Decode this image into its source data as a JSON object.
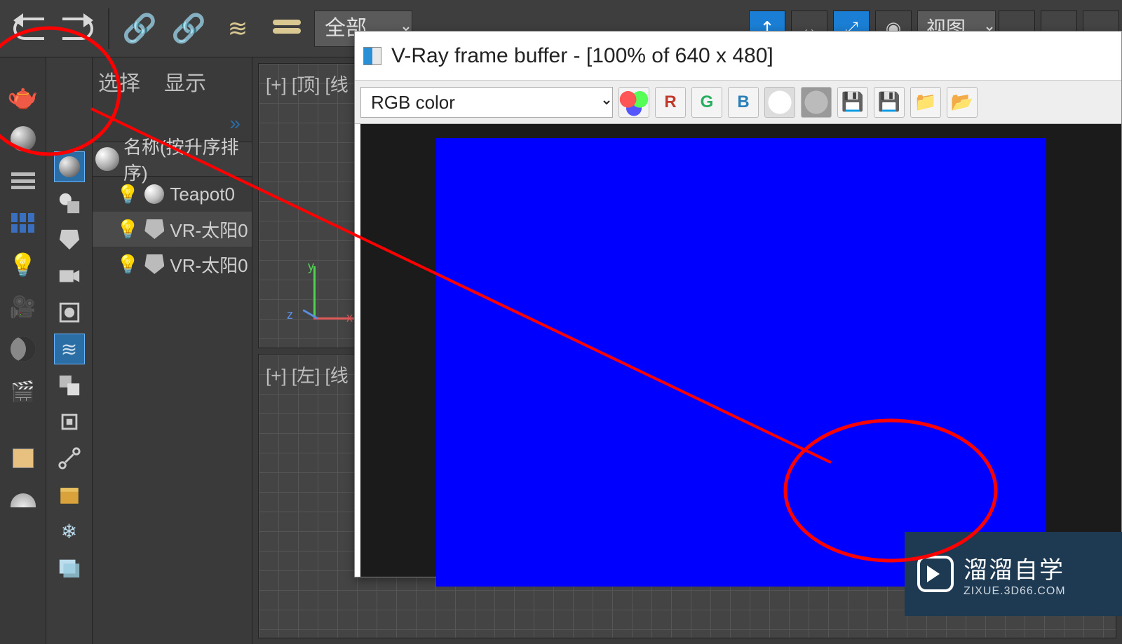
{
  "topbar": {
    "filter_label": "全部",
    "view_label": "视图"
  },
  "scene_explorer": {
    "tabs": {
      "select": "选择",
      "display": "显示"
    },
    "expand_glyph": "»",
    "column_header": "名称(按升序排序)",
    "items": [
      {
        "name": "Teapot0",
        "type": "geometry"
      },
      {
        "name": "VR-太阳0",
        "type": "light"
      },
      {
        "name": "VR-太阳0",
        "type": "light"
      }
    ]
  },
  "viewports": {
    "top_label": "[+] [顶] [线",
    "left_label": "[+] [左] [线",
    "axis": {
      "x": "x",
      "y": "y",
      "z": "z"
    }
  },
  "vfb": {
    "title": "V-Ray frame buffer - [100% of 640 x 480]",
    "channel_select": "RGB color",
    "buttons": {
      "r": "R",
      "g": "G",
      "b": "B"
    }
  },
  "watermark": {
    "title": "溜溜自学",
    "url": "ZIXUE.3D66.COM"
  }
}
